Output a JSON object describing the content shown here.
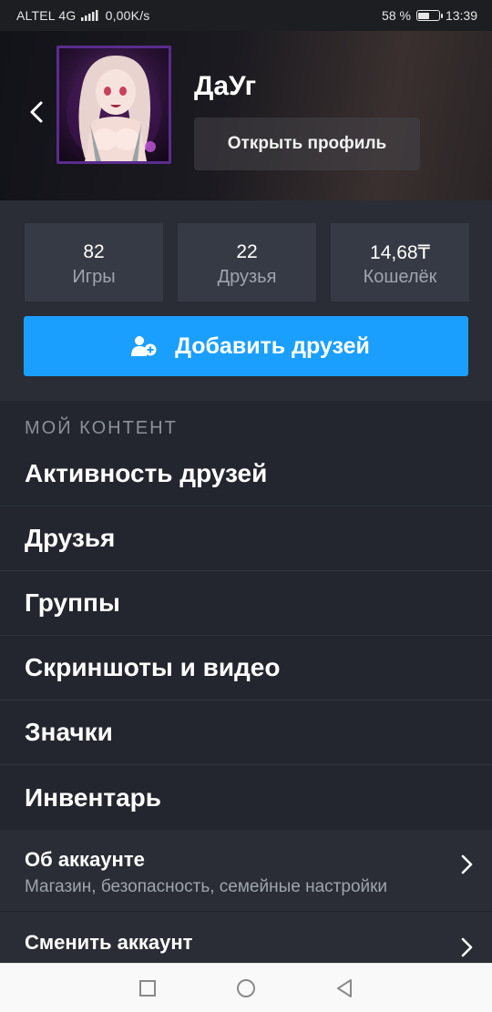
{
  "status_bar": {
    "carrier": "ALTEL 4G",
    "network_badge": "4G",
    "speed": "0,00K/s",
    "battery_percent": "58 %",
    "battery_level": 0.58,
    "time": "13:39"
  },
  "profile": {
    "username": "ДаУг",
    "open_profile_label": "Открыть профиль",
    "avatar": "anime-character-avatar"
  },
  "stats": [
    {
      "value": "82",
      "label": "Игры"
    },
    {
      "value": "22",
      "label": "Друзья"
    },
    {
      "value": "14,68₸",
      "label": "Кошелёк"
    }
  ],
  "add_friends_label": "Добавить друзей",
  "section_title": "МОЙ КОНТЕНТ",
  "menu": [
    {
      "label": "Активность друзей"
    },
    {
      "label": "Друзья"
    },
    {
      "label": "Группы"
    },
    {
      "label": "Скриншоты и видео"
    },
    {
      "label": "Значки"
    },
    {
      "label": "Инвентарь"
    }
  ],
  "details": [
    {
      "title": "Об аккаунте",
      "subtitle": "Магазин, безопасность, семейные настройки"
    },
    {
      "title": "Сменить аккаунт",
      "subtitle": ""
    }
  ],
  "colors": {
    "accent": "#1a9fff",
    "background": "#23262e",
    "stat_box": "#363a44",
    "avatar_border": "#5a2c8c"
  },
  "icons": [
    "back-arrow-icon",
    "add-user-icon",
    "chevron-right-icon",
    "signal-icon",
    "battery-icon",
    "recent-apps-icon",
    "home-icon",
    "back-icon"
  ]
}
